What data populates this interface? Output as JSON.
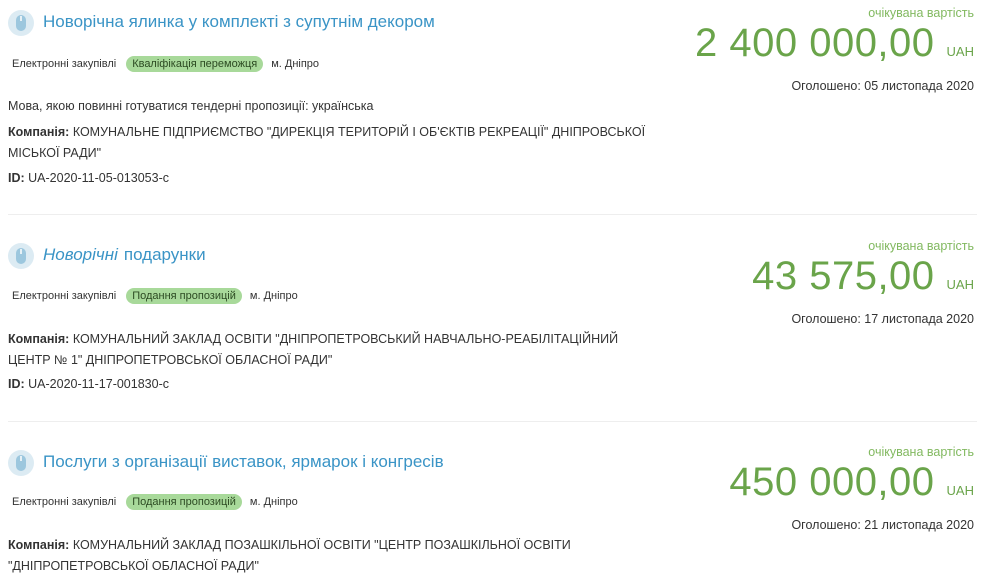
{
  "tenders": [
    {
      "title": "Новорічна ялинка у комплекті з супутнім декором",
      "procurement_type": "Електронні закупівлі",
      "status": "Кваліфікація переможця",
      "city": "м. Дніпро",
      "language_note": "Мова, якою повинні готуватися тендерні пропозиції: українська",
      "company_label": "Компанія:",
      "company_line1": "КОМУНАЛЬНЕ ПІДПРИЄМСТВО \"ДИРЕКЦІЯ ТЕРИТОРІЙ І ОБ'ЄКТІВ РЕКРЕАЦІЇ\" ДНІПРОВСЬКОЇ",
      "company_line2": "МІСЬКОЇ РАДИ\"",
      "id_label": "ID:",
      "id": "UA-2020-11-05-013053-c",
      "expected_label": "очікувана вартість",
      "price": "2 400 000,00",
      "currency": "UAH",
      "announced": "Оголошено: 05 листопада 2020"
    },
    {
      "title_em": "Новорічні",
      "title": "подарунки",
      "procurement_type": "Електронні закупівлі",
      "status": "Подання пропозицій",
      "city": "м. Дніпро",
      "company_label": "Компанія:",
      "company_line1": "КОМУНАЛЬНИЙ ЗАКЛАД ОСВІТИ \"ДНІПРОПЕТРОВСЬКИЙ НАВЧАЛЬНО-РЕАБІЛІТАЦІЙНИЙ",
      "company_line2": "ЦЕНТР № 1\" ДНІПРОПЕТРОВСЬКОЇ ОБЛАСНОЇ РАДИ\"",
      "id_label": "ID:",
      "id": "UA-2020-11-17-001830-c",
      "expected_label": "очікувана вартість",
      "price": "43 575,00",
      "currency": "UAH",
      "announced": "Оголошено: 17 листопада 2020"
    },
    {
      "title": "Послуги з організації виставок, ярмарок і конгресів",
      "procurement_type": "Електронні закупівлі",
      "status": "Подання пропозицій",
      "city": "м. Дніпро",
      "company_label": "Компанія:",
      "company_line1": "КОМУНАЛЬНИЙ ЗАКЛАД ПОЗАШКІЛЬНОЇ ОСВІТИ \"ЦЕНТР ПОЗАШКІЛЬНОЇ ОСВІТИ",
      "company_line2": "\"ДНІПРОПЕТРОВСЬКОЇ ОБЛАСНОЇ РАДИ\"",
      "expected_label": "очікувана вартість",
      "price": "450 000,00",
      "currency": "UAH",
      "announced": "Оголошено: 21 листопада 2020"
    }
  ],
  "colors": {
    "link": "#3a94c6",
    "price": "#6aa44a",
    "badge": "#a8d99a"
  },
  "icons": {
    "tender": "tender-mouse-icon"
  }
}
